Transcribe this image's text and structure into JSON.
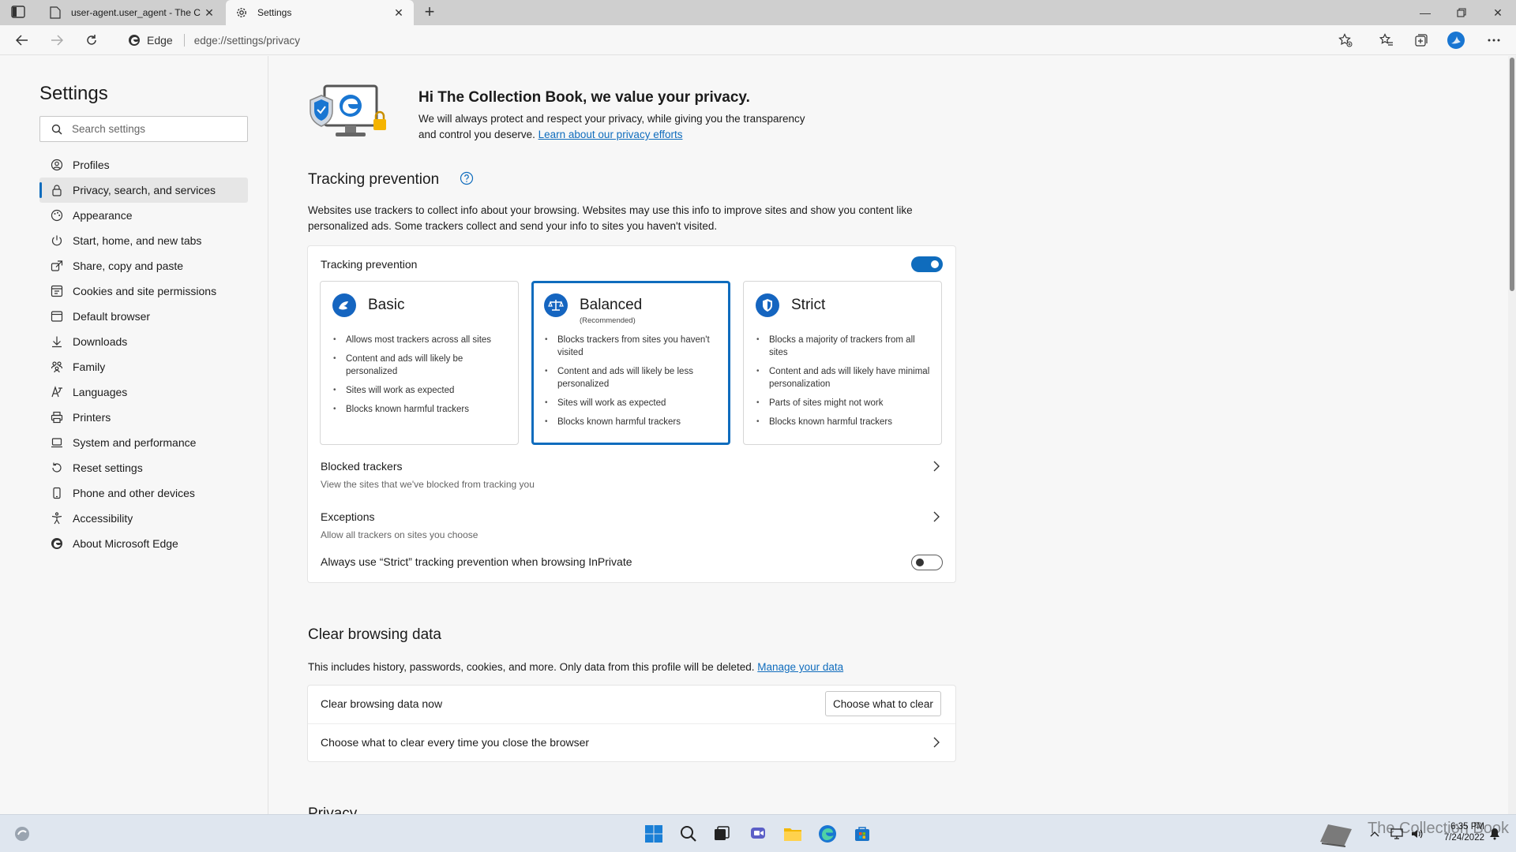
{
  "browser": {
    "tabs": [
      {
        "title": "user-agent.user_agent - The Coll",
        "active": false
      },
      {
        "title": "Settings",
        "active": true
      }
    ],
    "site_label": "Edge",
    "url": "edge://settings/privacy"
  },
  "sidebar": {
    "title": "Settings",
    "search_placeholder": "Search settings",
    "items": [
      {
        "label": "Profiles",
        "icon": "profile-icon"
      },
      {
        "label": "Privacy, search, and services",
        "icon": "lock-icon",
        "selected": true
      },
      {
        "label": "Appearance",
        "icon": "appearance-icon"
      },
      {
        "label": "Start, home, and new tabs",
        "icon": "power-icon"
      },
      {
        "label": "Share, copy and paste",
        "icon": "share-icon"
      },
      {
        "label": "Cookies and site permissions",
        "icon": "cookie-icon"
      },
      {
        "label": "Default browser",
        "icon": "browser-icon"
      },
      {
        "label": "Downloads",
        "icon": "download-icon"
      },
      {
        "label": "Family",
        "icon": "family-icon"
      },
      {
        "label": "Languages",
        "icon": "language-icon"
      },
      {
        "label": "Printers",
        "icon": "printer-icon"
      },
      {
        "label": "System and performance",
        "icon": "laptop-icon"
      },
      {
        "label": "Reset settings",
        "icon": "reset-icon"
      },
      {
        "label": "Phone and other devices",
        "icon": "phone-icon"
      },
      {
        "label": "Accessibility",
        "icon": "accessibility-icon"
      },
      {
        "label": "About Microsoft Edge",
        "icon": "edge-logo-icon"
      }
    ]
  },
  "hero": {
    "title": "Hi The Collection Book, we value your privacy.",
    "text_line1": "We will always protect and respect your privacy, while giving you the transparency",
    "text_line2": "and control you deserve.",
    "link": "Learn about our privacy efforts"
  },
  "tracking": {
    "section_title": "Tracking prevention",
    "desc_line1": "Websites use trackers to collect info about your browsing. Websites may use this info to improve sites and show you content like",
    "desc_line2": "personalized ads. Some trackers collect and send your info to sites you haven't visited.",
    "toggle_label": "Tracking prevention",
    "toggle_on": true,
    "modes": [
      {
        "title": "Basic",
        "subtitle": "",
        "selected": false,
        "bullets": [
          "Allows most trackers across all sites",
          "Content and ads will likely be personalized",
          "Sites will work as expected",
          "Blocks known harmful trackers"
        ]
      },
      {
        "title": "Balanced",
        "subtitle": "(Recommended)",
        "selected": true,
        "bullets": [
          "Blocks trackers from sites you haven't visited",
          "Content and ads will likely be less personalized",
          "Sites will work as expected",
          "Blocks known harmful trackers"
        ]
      },
      {
        "title": "Strict",
        "subtitle": "",
        "selected": false,
        "bullets": [
          "Blocks a majority of trackers from all sites",
          "Content and ads will likely have minimal personalization",
          "Parts of sites might not work",
          "Blocks known harmful trackers"
        ]
      }
    ],
    "blocked_label": "Blocked trackers",
    "blocked_sub": "View the sites that we've blocked from tracking you",
    "exceptions_label": "Exceptions",
    "exceptions_sub": "Allow all trackers on sites you choose",
    "strict_inprivate_label": "Always use “Strict” tracking prevention when browsing InPrivate",
    "strict_inprivate_on": false
  },
  "clear_data": {
    "section_title": "Clear browsing data",
    "desc": "This includes history, passwords, cookies, and more. Only data from this profile will be deleted.",
    "desc_link": "Manage your data",
    "now_label": "Clear browsing data now",
    "now_button": "Choose what to clear",
    "every_time_label": "Choose what to clear every time you close the browser"
  },
  "next_section_title": "Privacy",
  "taskbar": {
    "time": "6:35 PM",
    "date": "7/24/2022",
    "watermark": "The Collection Book"
  },
  "colors": {
    "accent": "#0f6cbd",
    "sidebar_selected": "#e6e6e6",
    "taskbar": "#dfe6ef"
  }
}
